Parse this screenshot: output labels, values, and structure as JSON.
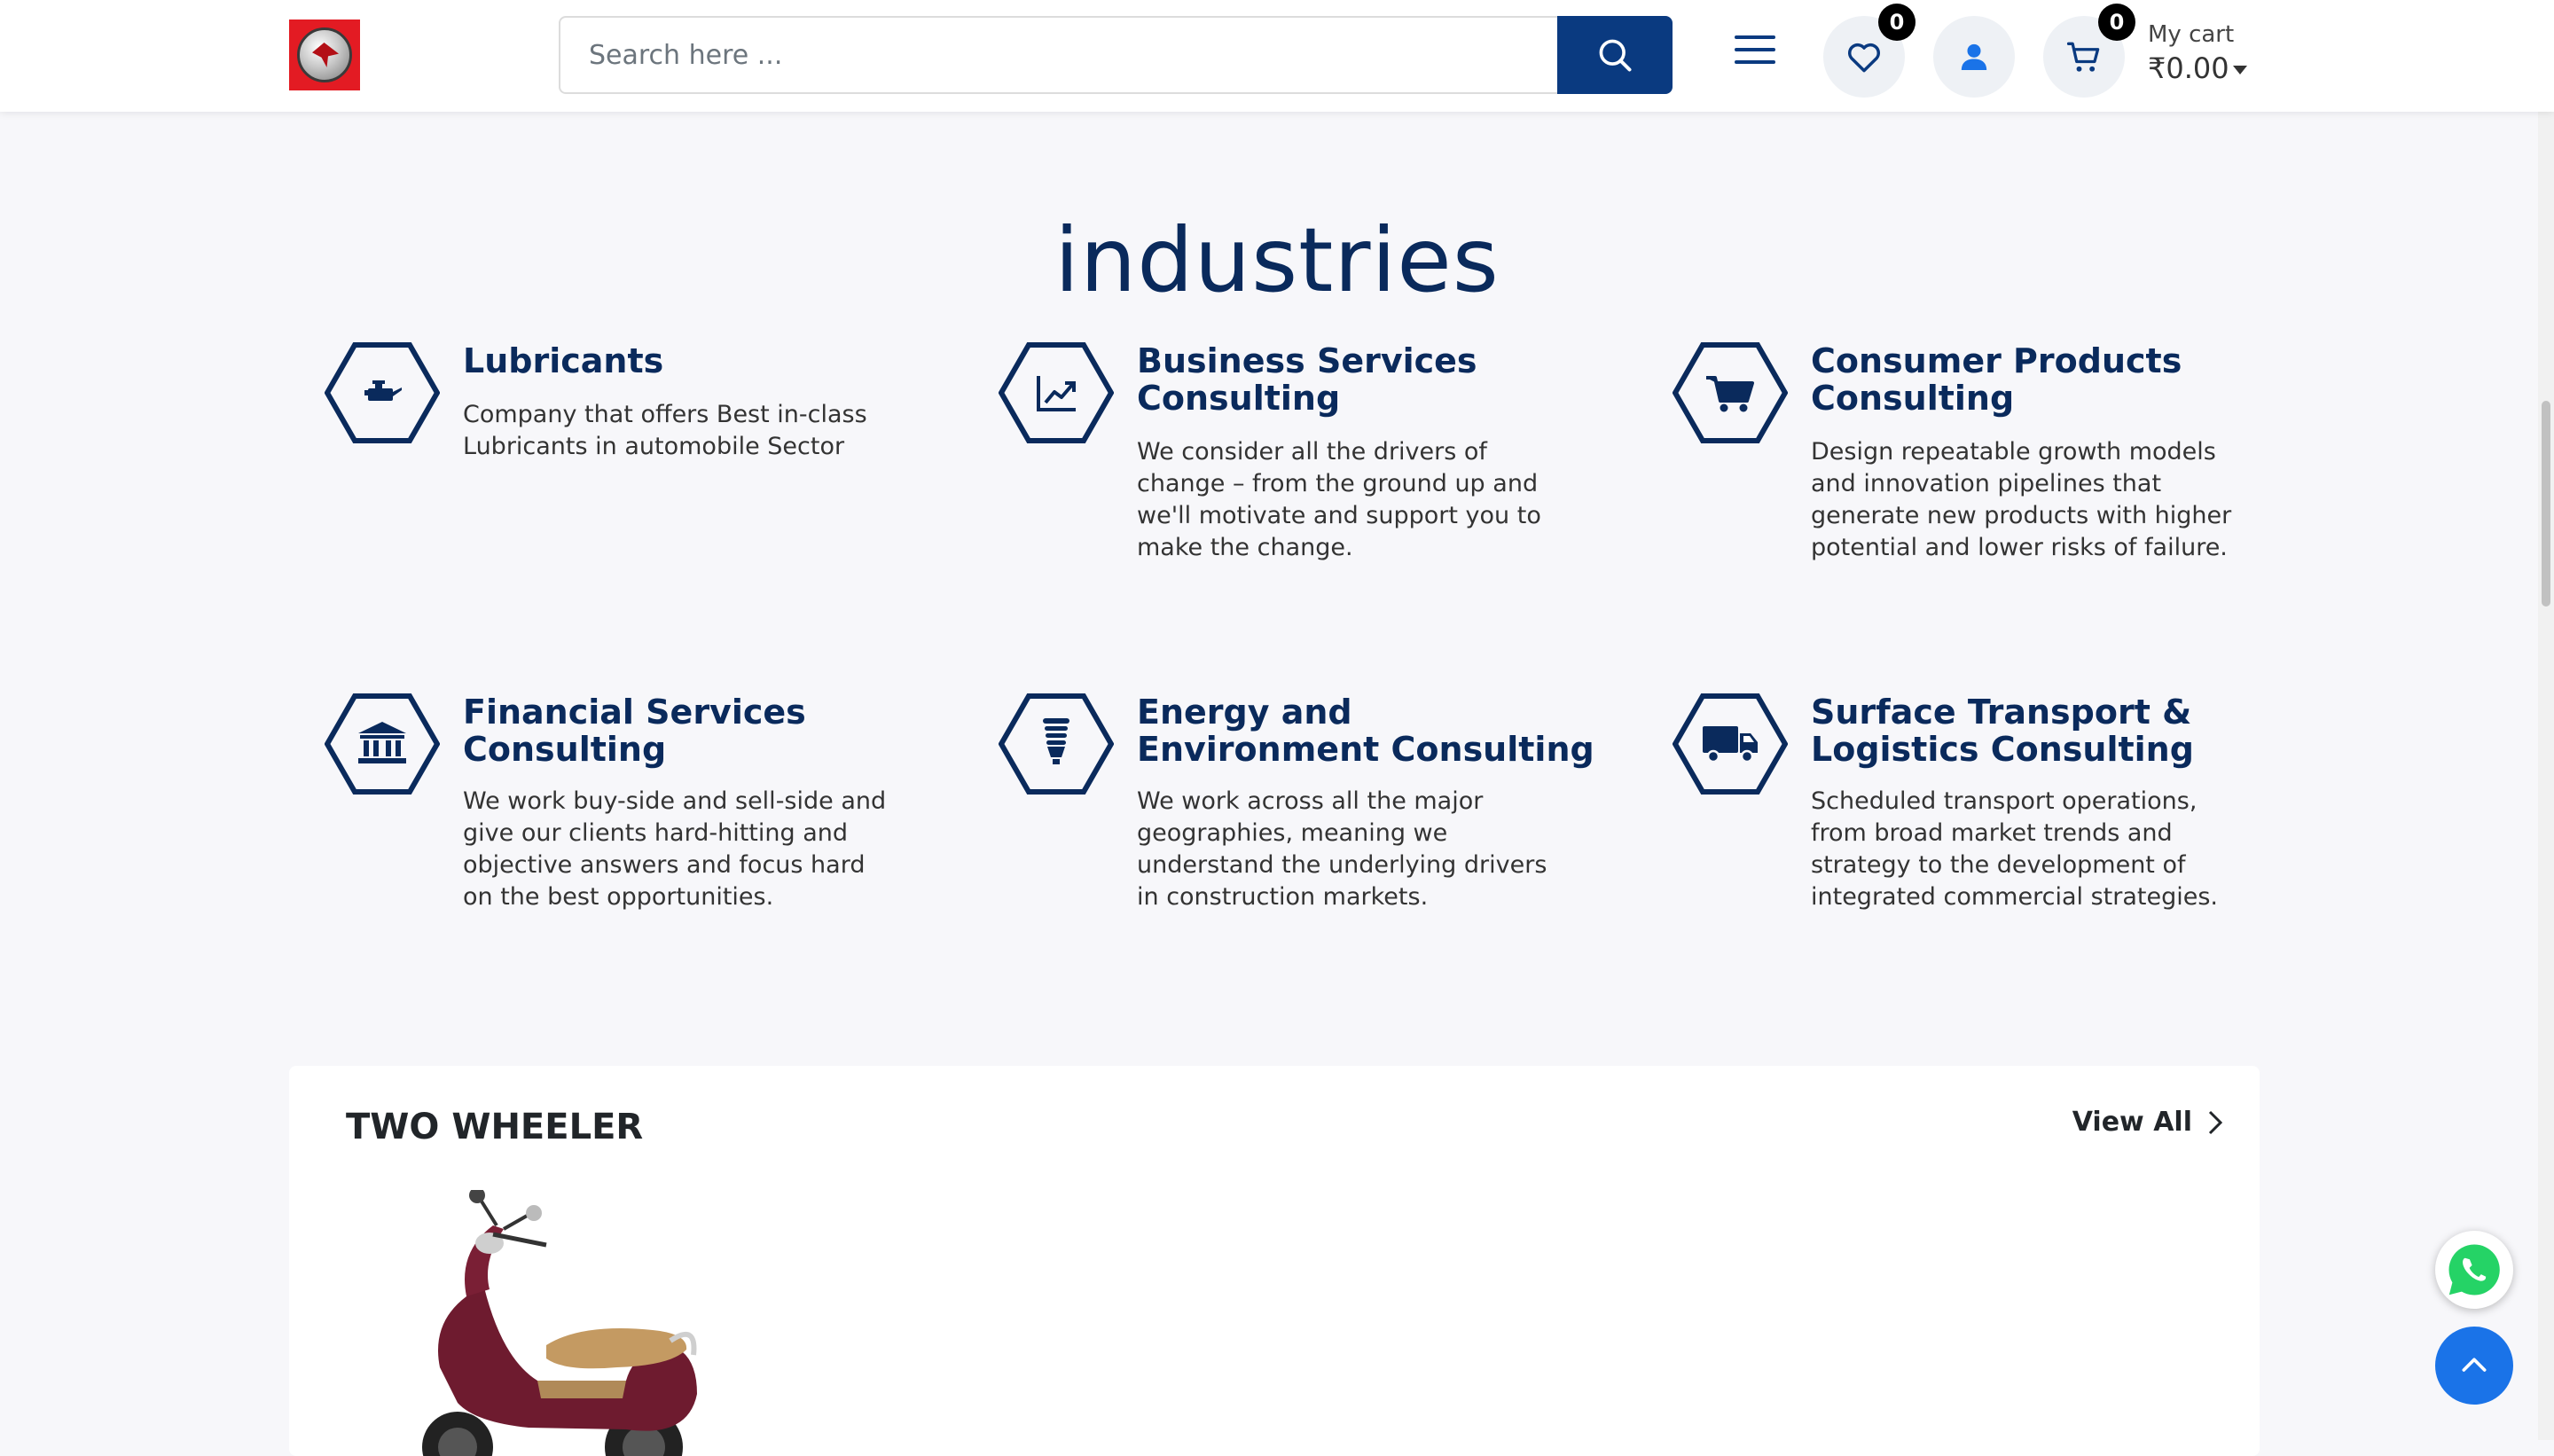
{
  "header": {
    "logo_icon": "brand-logo",
    "search_placeholder": "Search here ...",
    "wishlist_count": "0",
    "cart_count": "0",
    "cart_label": "My cart",
    "cart_amount": "₹0.00"
  },
  "section": {
    "title": "industries"
  },
  "industries": [
    {
      "icon": "oil-can-icon",
      "title": "Lubricants",
      "desc": "Company that offers Best in-class Lubricants in automobile Sector"
    },
    {
      "icon": "chart-line-icon",
      "title": "Business Services Consulting",
      "desc": "We consider all the drivers of change – from the ground up and we'll motivate and support you to make the change."
    },
    {
      "icon": "shopping-cart-icon",
      "title": "Consumer Products Consulting",
      "desc": "Design repeatable growth models and innovation pipelines that generate new products with higher potential and lower risks of failure."
    },
    {
      "icon": "bank-icon",
      "title": "Financial Services Consulting",
      "desc": "We work buy-side and sell-side and give our clients hard-hitting and objective answers and focus hard on the best opportunities."
    },
    {
      "icon": "lightbulb-icon",
      "title": "Energy and Environment Consulting",
      "desc": "We work across all the major geographies, meaning we understand the underlying drivers in construction markets."
    },
    {
      "icon": "truck-icon",
      "title": "Surface Transport & Logistics Consulting",
      "desc": "Scheduled transport operations, from broad market trends and strategy to the development of integrated commercial strategies."
    }
  ],
  "products": {
    "title": "TWO WHEELER",
    "view_all": "View All"
  },
  "colors": {
    "brand_navy": "#0a2a5c",
    "search_button": "#0a3a80",
    "logo_red": "#e31b23",
    "back_to_top": "#1a73e8",
    "whatsapp": "#25d366"
  }
}
